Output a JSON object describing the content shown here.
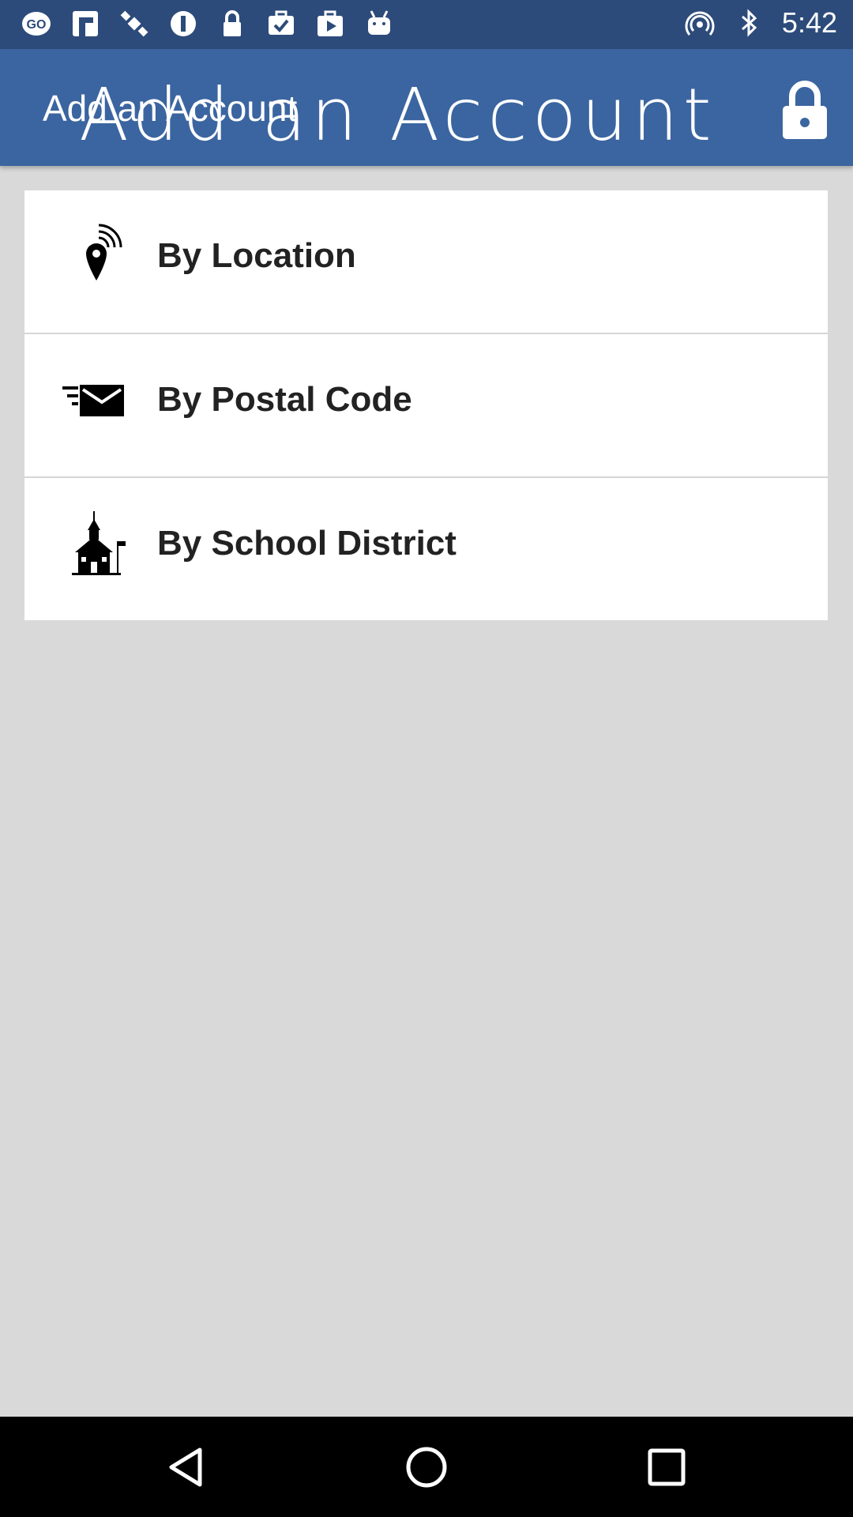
{
  "status_bar": {
    "time": "5:42",
    "left_icons": [
      "go-icon",
      "fake-gps-icon",
      "satellite-icon",
      "info-icon",
      "lock-icon",
      "briefcase-check-icon",
      "play-store-icon",
      "android-icon"
    ],
    "right_icons": [
      "hotspot-icon",
      "bluetooth-icon"
    ]
  },
  "app_bar": {
    "title_small": "Add an Account",
    "title_large": "Add an Account",
    "background": "#3b65a0"
  },
  "options": [
    {
      "label": "By Location",
      "icon": "location-pin-icon"
    },
    {
      "label": "By Postal Code",
      "icon": "mail-icon"
    },
    {
      "label": "By School District",
      "icon": "schoolhouse-icon"
    }
  ],
  "nav_bar": {
    "buttons": [
      "back-icon",
      "home-icon",
      "recents-icon"
    ]
  }
}
